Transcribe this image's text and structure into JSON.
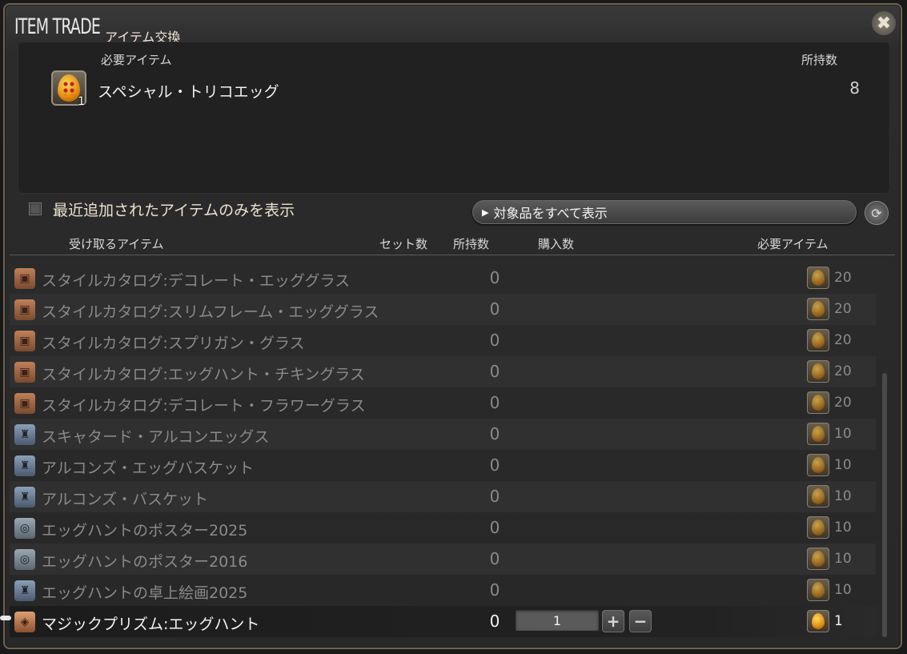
{
  "window": {
    "title": "ITEM TRADE",
    "subtitle": "アイテム交換",
    "close_icon": "close-x-icon"
  },
  "required_panel": {
    "header_item": "必要アイテム",
    "header_owned": "所持数",
    "item": {
      "name": "スペシャル・トリコエッグ",
      "count_badge": "1",
      "owned": "8",
      "icon": "egg-icon"
    }
  },
  "filter": {
    "checkbox_label": "最近追加されたアイテムのみを表示",
    "checked": false,
    "show_all_label": "対象品をすべて表示"
  },
  "columns": {
    "received": "受け取るアイテム",
    "set_count": "セット数",
    "owned": "所持数",
    "purchase": "購入数",
    "required": "必要アイテム"
  },
  "rows": [
    {
      "name": "スタイルカタログ:デコレート・エッググラス",
      "owned": "0",
      "req_count": "20",
      "icon": "catalog"
    },
    {
      "name": "スタイルカタログ:スリムフレーム・エッググラス",
      "owned": "0",
      "req_count": "20",
      "icon": "catalog"
    },
    {
      "name": "スタイルカタログ:スプリガン・グラス",
      "owned": "0",
      "req_count": "20",
      "icon": "catalog"
    },
    {
      "name": "スタイルカタログ:エッグハント・チキングラス",
      "owned": "0",
      "req_count": "20",
      "icon": "catalog"
    },
    {
      "name": "スタイルカタログ:デコレート・フラワーグラス",
      "owned": "0",
      "req_count": "20",
      "icon": "catalog"
    },
    {
      "name": "スキャタード・アルコンエッグス",
      "owned": "0",
      "req_count": "10",
      "icon": "furniture"
    },
    {
      "name": "アルコンズ・エッグバスケット",
      "owned": "0",
      "req_count": "10",
      "icon": "furniture"
    },
    {
      "name": "アルコンズ・バスケット",
      "owned": "0",
      "req_count": "10",
      "icon": "furniture"
    },
    {
      "name": "エッグハントのポスター2025",
      "owned": "0",
      "req_count": "10",
      "icon": "poster"
    },
    {
      "name": "エッグハントのポスター2016",
      "owned": "0",
      "req_count": "10",
      "icon": "poster"
    },
    {
      "name": "エッグハントの卓上絵画2025",
      "owned": "0",
      "req_count": "10",
      "icon": "furniture"
    },
    {
      "name": "マジックプリズム:エッグハント",
      "owned": "0",
      "req_count": "1",
      "icon": "prism",
      "selected": true,
      "quantity": "1"
    }
  ],
  "stepper": {
    "plus": "+",
    "minus": "−"
  }
}
